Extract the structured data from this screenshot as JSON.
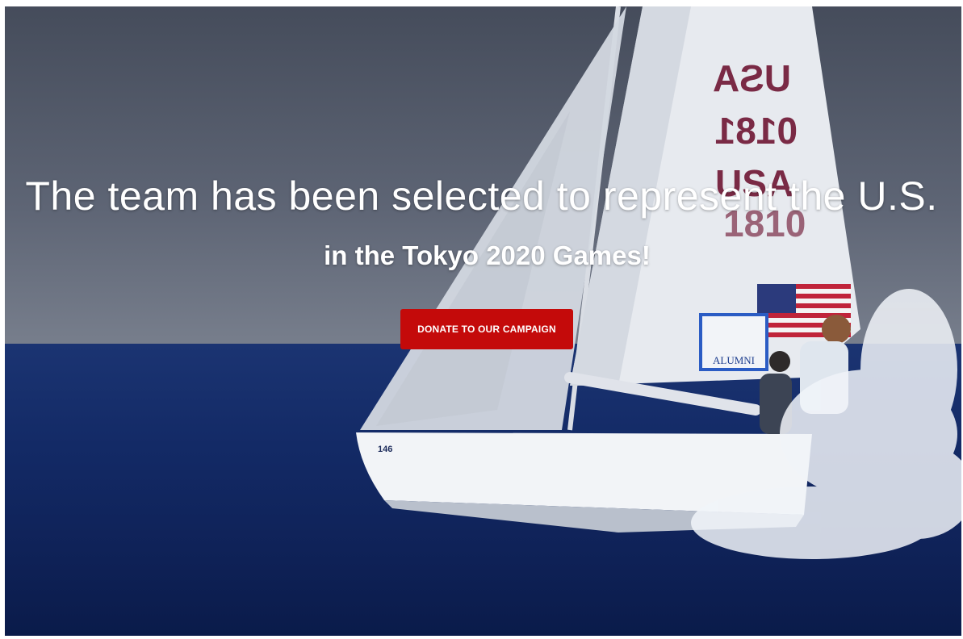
{
  "hero": {
    "headline": "The team has been selected to represent the U.S.",
    "subheadline": "in the Tokyo 2020 Games!",
    "cta_label": "DONATE TO OUR CAMPAIGN",
    "sail_text": [
      "USA",
      "0181",
      "USA",
      "1810"
    ],
    "banner_text": "ALUMNI",
    "hull_text": "146",
    "background_image": "sailboat-racing-on-open-sea"
  },
  "colors": {
    "cta_background": "#c40a0a",
    "text": "#ffffff",
    "sea": "#132a66",
    "sky": "#5e6575"
  }
}
